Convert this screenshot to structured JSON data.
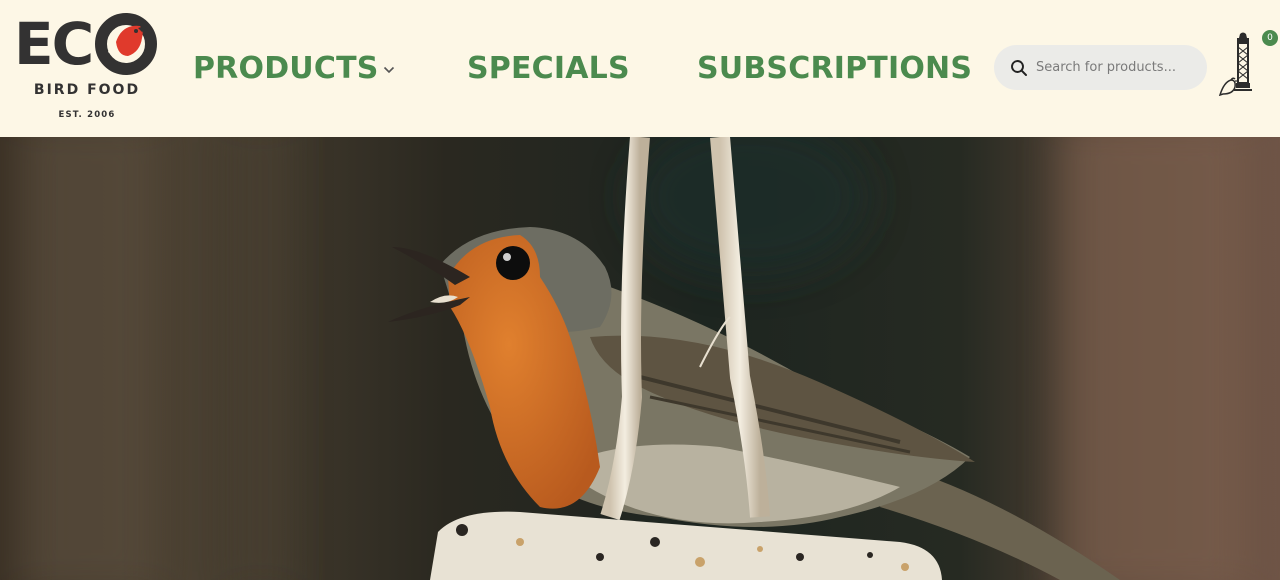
{
  "brand": {
    "logo_letters": "EC",
    "logo_subtitle": "BIRD FOOD",
    "logo_est": "EST. 2006",
    "accent_color": "#e03a2c",
    "text_color": "#333232"
  },
  "nav": {
    "items": [
      {
        "label": "PRODUCTS",
        "has_dropdown": true
      },
      {
        "label": "SPECIALS",
        "has_dropdown": false
      },
      {
        "label": "SUBSCRIPTIONS",
        "has_dropdown": false
      }
    ],
    "color": "#4b8a4e"
  },
  "search": {
    "placeholder": "Search for products...",
    "value": "",
    "icon": "search-icon"
  },
  "cart": {
    "icon": "bird-feeder-cart-icon",
    "count": "0"
  },
  "hero": {
    "image_alt": "Robin perched on a hanging suet feeder"
  }
}
